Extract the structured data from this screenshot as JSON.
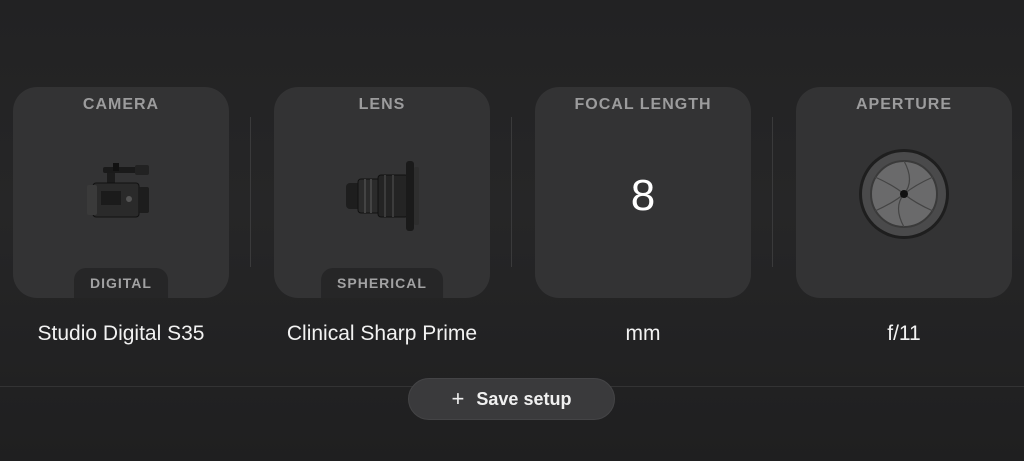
{
  "cards": [
    {
      "title": "CAMERA",
      "badge": "DIGITAL",
      "value": "Studio Digital S35",
      "icon": "cinema-camera-icon"
    },
    {
      "title": "LENS",
      "badge": "SPHERICAL",
      "value": "Clinical Sharp Prime",
      "icon": "lens-icon"
    },
    {
      "title": "FOCAL LENGTH",
      "number": "8",
      "value": "mm"
    },
    {
      "title": "APERTURE",
      "value": "f/11",
      "icon": "aperture-icon"
    }
  ],
  "actions": {
    "save_label": "Save setup",
    "save_icon": "plus-icon"
  },
  "colors": {
    "background": "#242425",
    "card": "#333334",
    "button": "#3a3a3c",
    "label": "#9c9c9d"
  }
}
